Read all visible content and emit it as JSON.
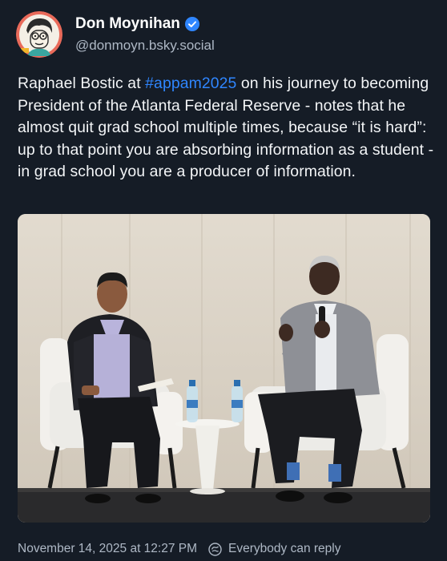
{
  "author": {
    "display_name": "Don Moynihan",
    "handle": "@donmoyn.bsky.social",
    "avatar_icon": "cartoon-avatar",
    "verified_icon": "verified-check-icon"
  },
  "post": {
    "text_before": "Raphael Bostic at ",
    "hashtag": "#appam2025",
    "text_after": " on his journey to becoming President of the Atlanta Federal Reserve - notes that he almost quit grad school multiple times, because “it is hard”: up to that point you are absorbing information as a student - in grad school you are a producer of information."
  },
  "media": {
    "type": "photo",
    "subject": "two men seated on white armchairs on a stage, one speaking into a microphone"
  },
  "footer": {
    "timestamp": "November 14, 2025 at 12:27 PM",
    "reply_setting": "Everybody can reply",
    "reply_icon": "anyone-can-reply-icon"
  },
  "colors": {
    "background": "#151c26",
    "link": "#2f86ff",
    "verified": "#2f86ff",
    "muted_text": "#aeb8c5"
  }
}
